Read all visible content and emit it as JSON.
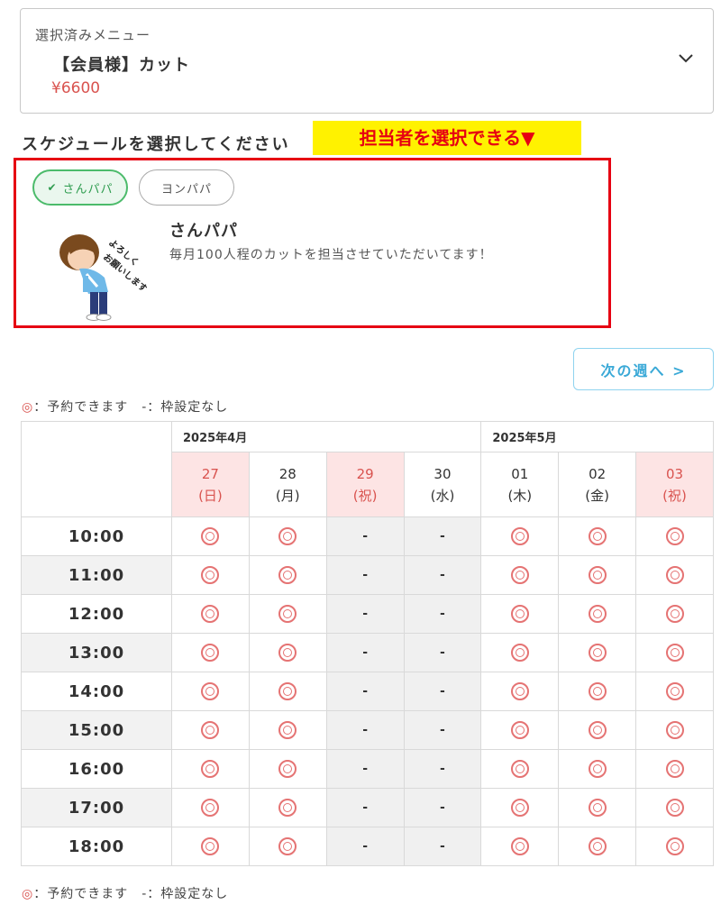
{
  "menu": {
    "caption": "選択済みメニュー",
    "item_name": "【会員様】カット",
    "price": "¥6600"
  },
  "schedule": {
    "title": "スケジュールを選択してください",
    "callout": "担当者を選択できる▼"
  },
  "staff": {
    "options": [
      {
        "label": "さんパパ",
        "selected": true
      },
      {
        "label": "ヨンパパ",
        "selected": false
      }
    ],
    "name": "さんパパ",
    "description": "毎月100人程のカットを担当させていただいてます！",
    "avatar_text": "よろしく お願いします"
  },
  "next_week": "次の週へ >",
  "legend": {
    "mark": "◎",
    "text": "：予約できます　-：枠設定なし"
  },
  "table": {
    "months": [
      "2025年4月",
      "2025年5月"
    ],
    "days": [
      {
        "num": "27",
        "dow": "(日)",
        "holiday": true
      },
      {
        "num": "28",
        "dow": "(月)",
        "holiday": false
      },
      {
        "num": "29",
        "dow": "(祝)",
        "holiday": true
      },
      {
        "num": "30",
        "dow": "(水)",
        "holiday": false
      },
      {
        "num": "01",
        "dow": "(木)",
        "holiday": false
      },
      {
        "num": "02",
        "dow": "(金)",
        "holiday": false
      },
      {
        "num": "03",
        "dow": "(祝)",
        "holiday": true
      }
    ],
    "rows": [
      {
        "time": "10:00",
        "slots": [
          "◎",
          "◎",
          "-",
          "-",
          "◎",
          "◎",
          "◎"
        ]
      },
      {
        "time": "11:00",
        "slots": [
          "◎",
          "◎",
          "-",
          "-",
          "◎",
          "◎",
          "◎"
        ]
      },
      {
        "time": "12:00",
        "slots": [
          "◎",
          "◎",
          "-",
          "-",
          "◎",
          "◎",
          "◎"
        ]
      },
      {
        "time": "13:00",
        "slots": [
          "◎",
          "◎",
          "-",
          "-",
          "◎",
          "◎",
          "◎"
        ]
      },
      {
        "time": "14:00",
        "slots": [
          "◎",
          "◎",
          "-",
          "-",
          "◎",
          "◎",
          "◎"
        ]
      },
      {
        "time": "15:00",
        "slots": [
          "◎",
          "◎",
          "-",
          "-",
          "◎",
          "◎",
          "◎"
        ]
      },
      {
        "time": "16:00",
        "slots": [
          "◎",
          "◎",
          "-",
          "-",
          "◎",
          "◎",
          "◎"
        ]
      },
      {
        "time": "17:00",
        "slots": [
          "◎",
          "◎",
          "-",
          "-",
          "◎",
          "◎",
          "◎"
        ]
      },
      {
        "time": "18:00",
        "slots": [
          "◎",
          "◎",
          "-",
          "-",
          "◎",
          "◎",
          "◎"
        ]
      }
    ]
  },
  "colors": {
    "accent_red": "#e60012",
    "callout_bg": "#fff200",
    "selected_green": "#4cbb6b",
    "holiday_bg": "#fde4e4",
    "available_mark": "#e57373",
    "link_blue": "#3aa9d7"
  }
}
